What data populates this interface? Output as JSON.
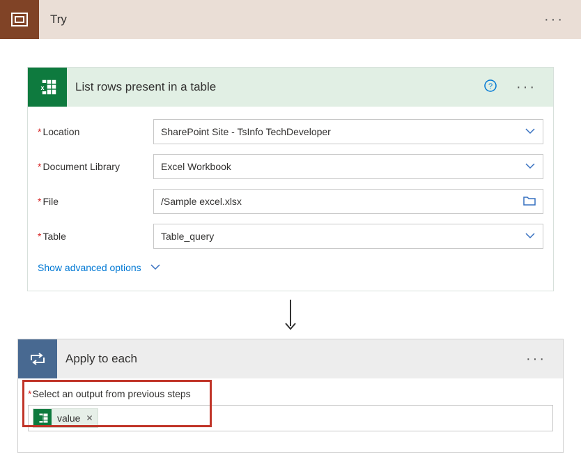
{
  "topbar": {
    "title": "Try"
  },
  "card1": {
    "title": "List rows present in a table",
    "fields": {
      "location": {
        "label": "Location",
        "value": "SharePoint Site - TsInfo TechDeveloper"
      },
      "library": {
        "label": "Document Library",
        "value": "Excel Workbook"
      },
      "file": {
        "label": "File",
        "value": "/Sample excel.xlsx"
      },
      "table": {
        "label": "Table",
        "value": "Table_query"
      }
    },
    "advanced": "Show advanced options"
  },
  "card2": {
    "title": "Apply to each",
    "select_label": "Select an output from previous steps",
    "token": "value"
  }
}
